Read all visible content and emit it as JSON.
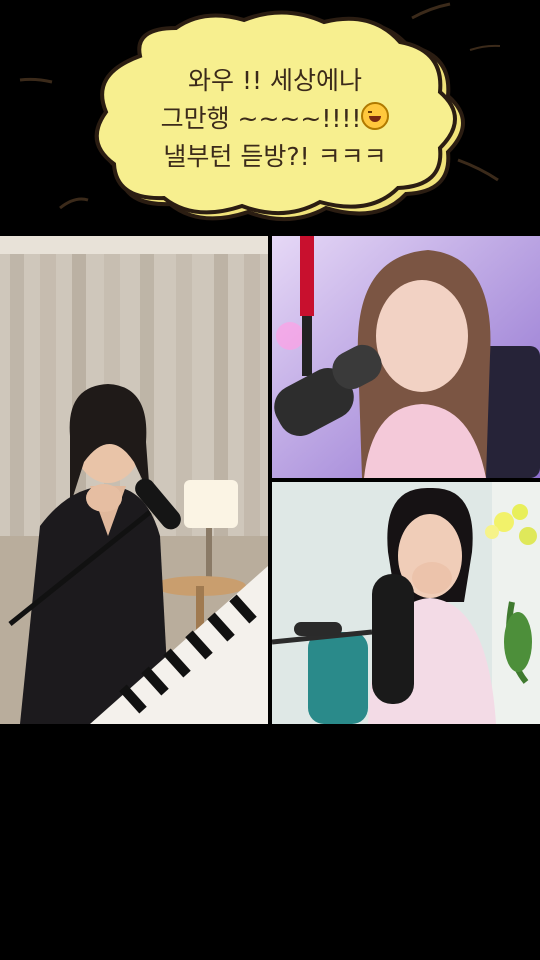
{
  "caption": {
    "lines": [
      "와우 !! 세상에나",
      "그만행 ~~~~!!!!",
      "낼부턴 듣방?! ㅋㅋㅋ"
    ],
    "emoji": "rofl-emoji",
    "bubble_color": "#f7ef8f"
  },
  "panels": [
    {
      "id": "singer-piano",
      "background": "#d9d2c8"
    },
    {
      "id": "streamer-top",
      "background": "#c9b6e8"
    },
    {
      "id": "streamer-bottom",
      "background": "#dfe8e6"
    }
  ]
}
